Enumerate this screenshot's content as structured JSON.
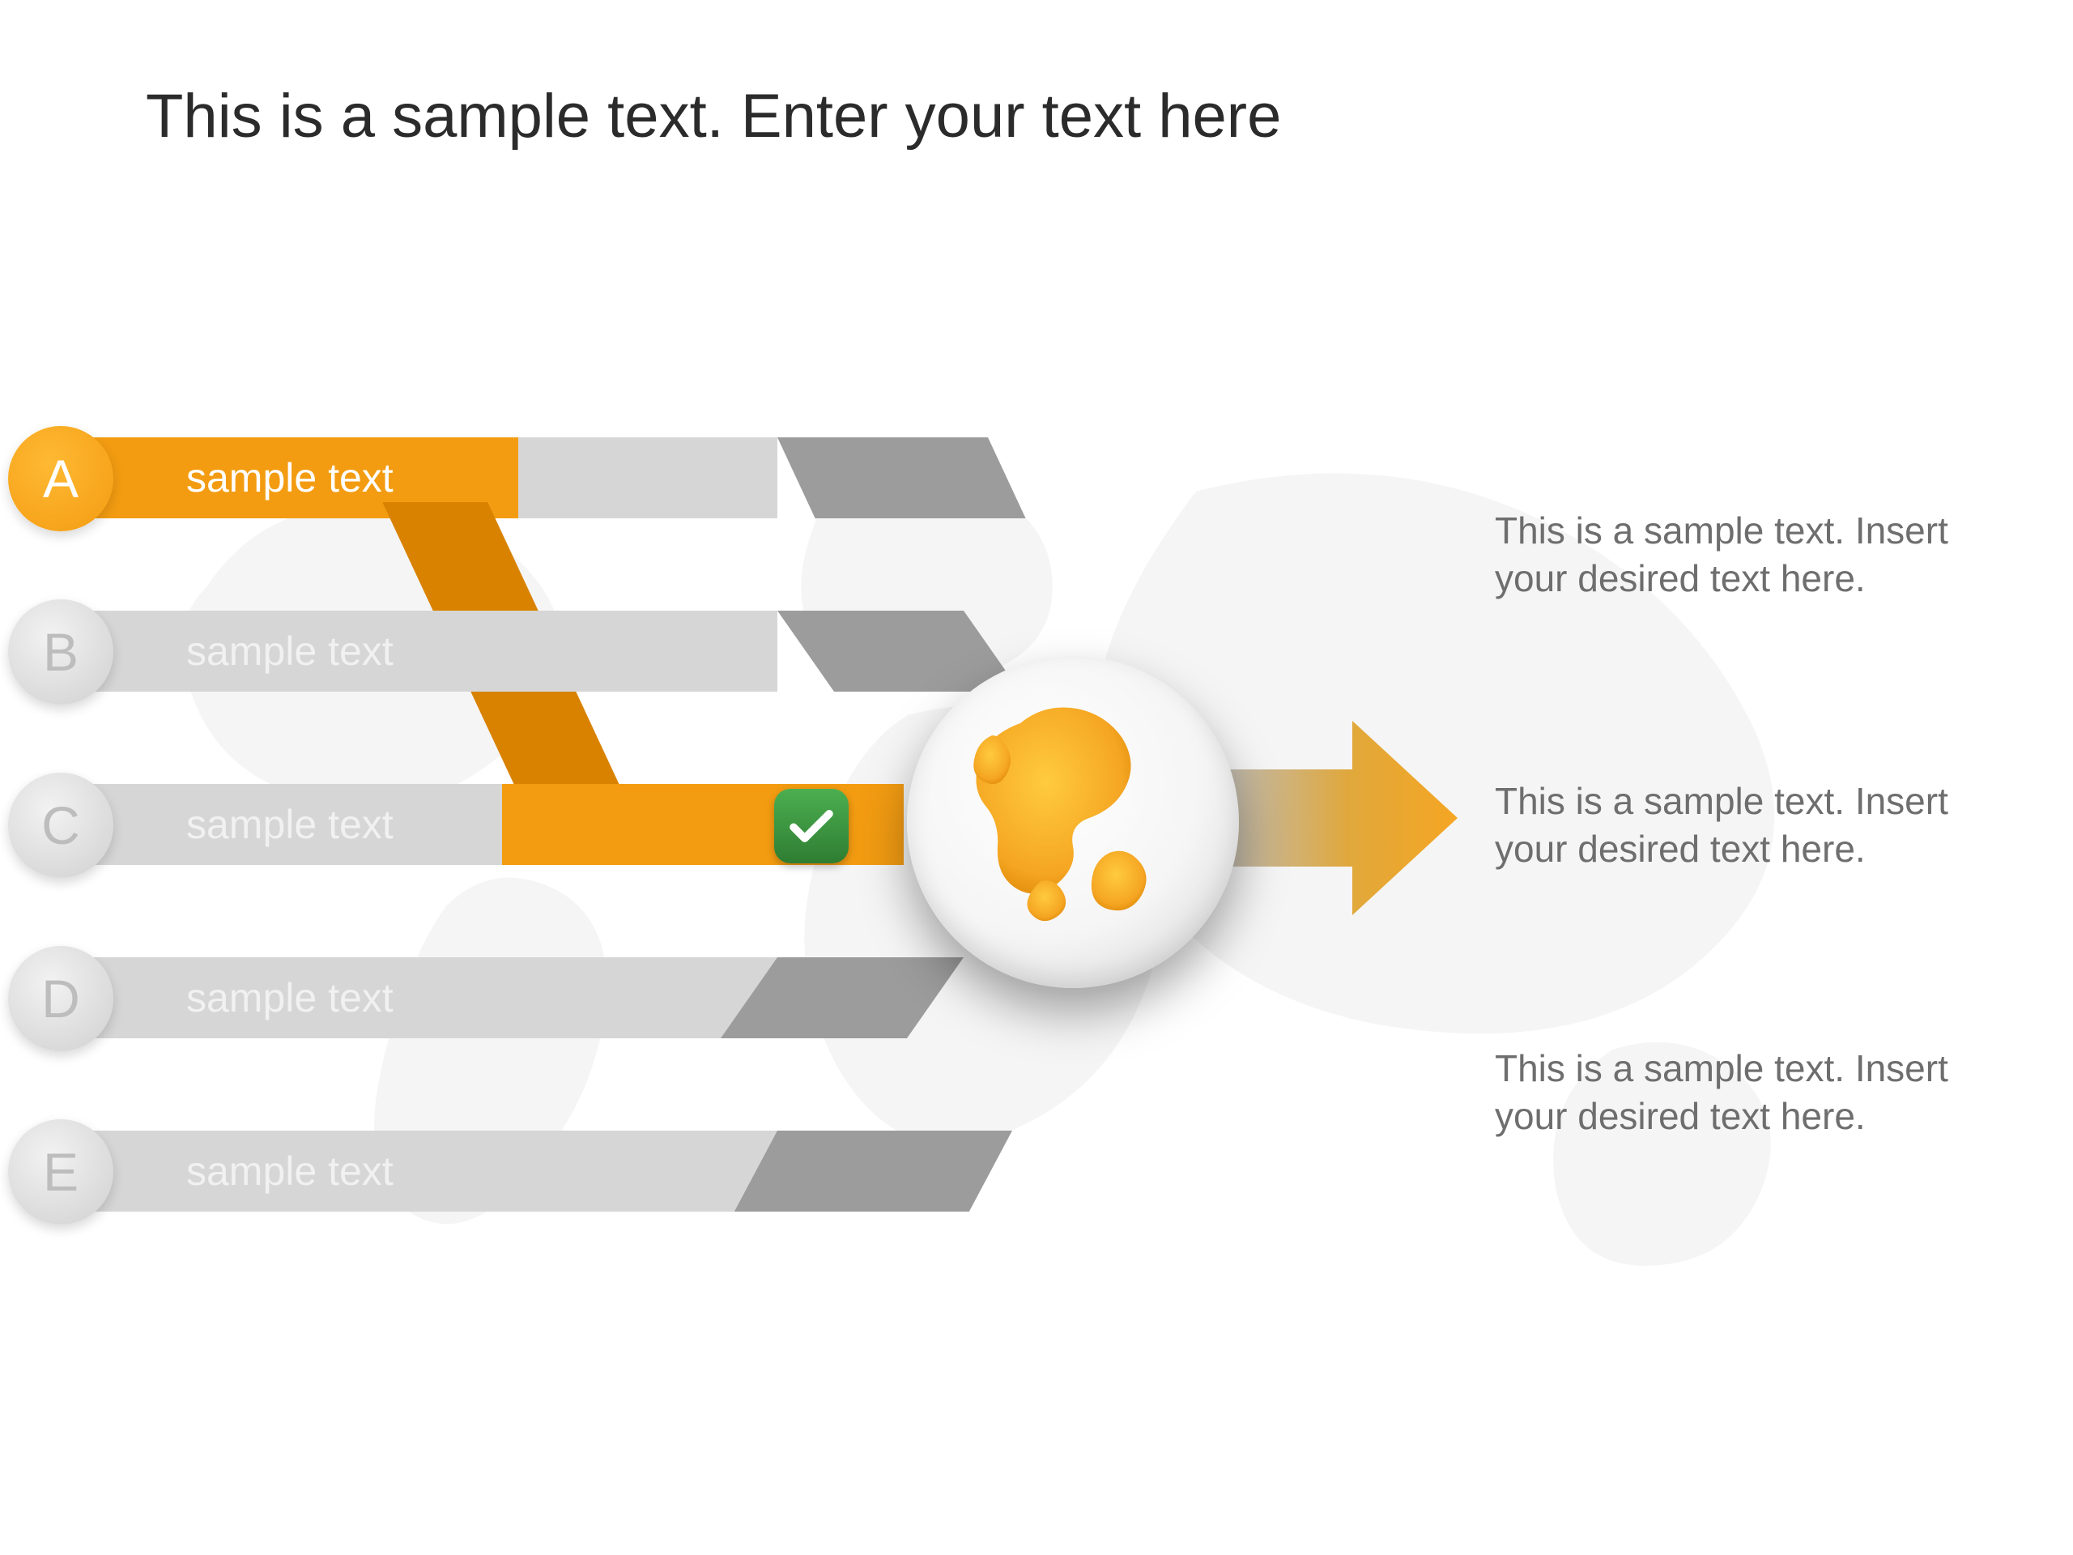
{
  "title": "This is a sample text. Enter your text here",
  "items": [
    {
      "letter": "A",
      "label": "sample text",
      "active": true
    },
    {
      "letter": "B",
      "label": "sample text",
      "active": false
    },
    {
      "letter": "C",
      "label": "sample text",
      "active": false
    },
    {
      "letter": "D",
      "label": "sample text",
      "active": false
    },
    {
      "letter": "E",
      "label": "sample text",
      "active": false
    }
  ],
  "right_blocks": [
    "This is a sample text. Insert your desired text here.",
    "This is a sample text. Insert your desired text here.",
    "This is a sample text. Insert your desired text here."
  ],
  "colors": {
    "accent": "#f39c12",
    "accent_dark": "#d98200",
    "grey_light": "#d6d6d6",
    "grey_dark": "#9c9c9c",
    "check": "#3aa63a"
  }
}
